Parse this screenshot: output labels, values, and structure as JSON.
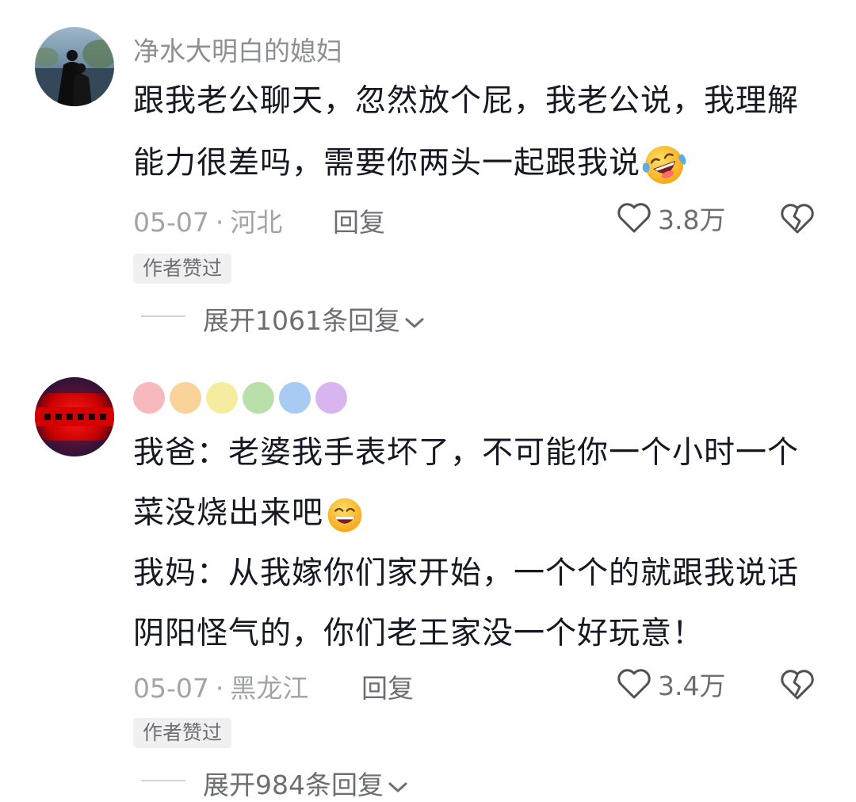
{
  "comments": [
    {
      "username": "净水大明白的媳妇",
      "lines": [
        "跟我老公聊天，忽然放个屁，我老公说，我理解",
        "能力很差吗，需要你两头一起跟我说"
      ],
      "date": "05-07",
      "dot": "·",
      "location": "河北",
      "reply_label": "回复",
      "likes": "3.8万",
      "badge": "作者赞过",
      "expand_label": "展开1061条回复"
    },
    {
      "username_dots_colors": [
        "#f7b9bd",
        "#f9d39a",
        "#f6eca0",
        "#b9e0a8",
        "#a7cbf2",
        "#d8b5ee"
      ],
      "lines": [
        "我爸：老婆我手表坏了，不可能你一个小时一个",
        "菜没烧出来吧",
        "我妈：从我嫁你们家开始，一个个的就跟我说话",
        "阴阳怪气的，你们老王家没一个好玩意！"
      ],
      "date": "05-07",
      "dot": "·",
      "location": "黑龙江",
      "reply_label": "回复",
      "likes": "3.4万",
      "badge": "作者赞过",
      "expand_label": "展开984条回复"
    }
  ],
  "icons": {
    "like": "heart-outline-icon",
    "dislike": "broken-heart-icon",
    "expand": "chevron-down-icon",
    "emoji_1": "laughing-tears-emoji",
    "emoji_2": "grinning-emoji"
  },
  "colors": {
    "text": "#161823",
    "secondary": "#8e8f94",
    "badge_bg": "#f0f0f2"
  }
}
